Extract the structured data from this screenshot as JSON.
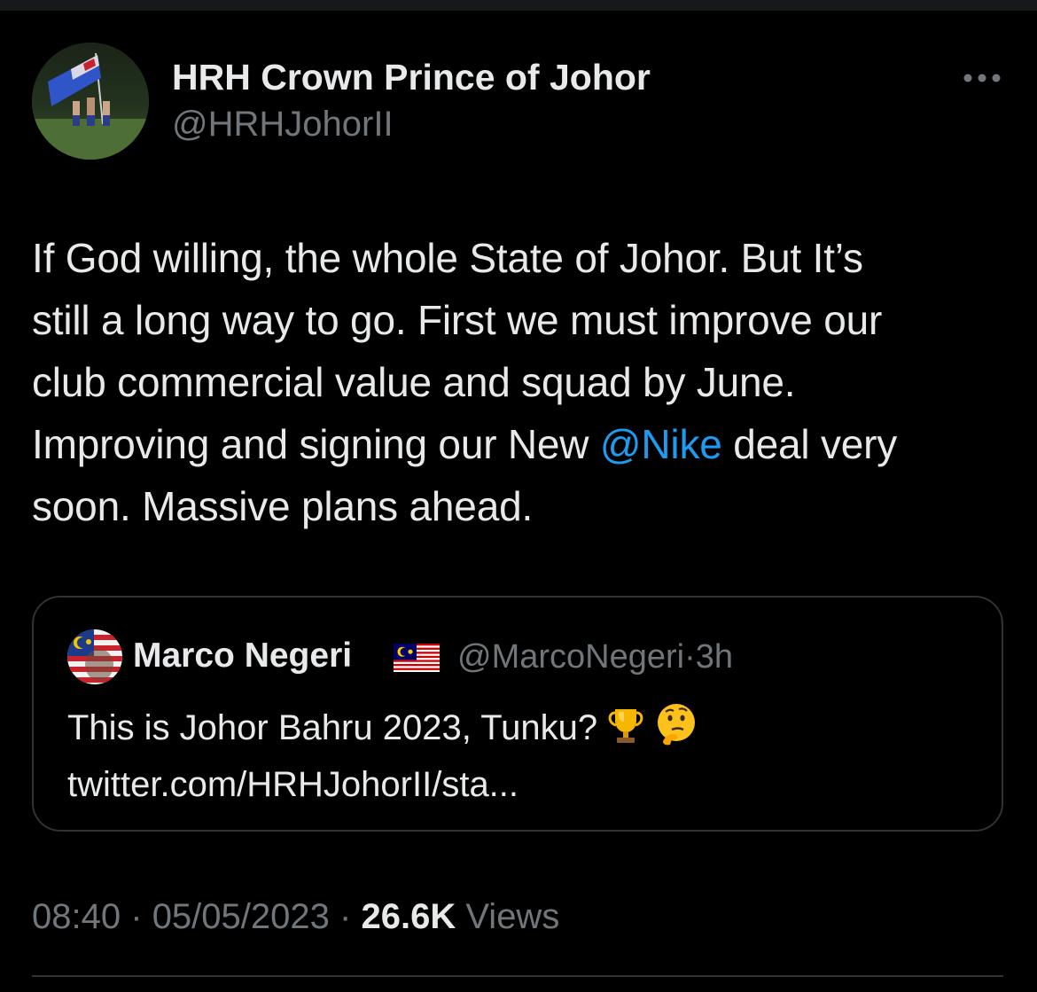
{
  "author": {
    "name": "HRH Crown Prince of Johor",
    "handle": "@HRHJohorII"
  },
  "tweet": {
    "lines": [
      "If God willing, the whole State of Johor. But It’s",
      "still a long way to go. First we must improve our",
      "club commercial value and squad by June."
    ],
    "line4_before": "Improving and signing our New ",
    "mention": "@Nike",
    "line4_after": " deal very",
    "line5": "soon. Massive plans ahead."
  },
  "quote": {
    "name": "Marco Negeri",
    "handle": "@MarcoNegeri",
    "separator": "·",
    "time": "3h",
    "text_line1": "This is Johor Bahru 2023, Tunku?",
    "text_line2": "twitter.com/HRHJohorII/sta...",
    "emojis": [
      "trophy-emoji",
      "thinking-face-emoji"
    ]
  },
  "meta": {
    "time": "08:40",
    "date": "05/05/2023",
    "separator": "·",
    "views_count": "26.6K",
    "views_label": "Views"
  },
  "colors": {
    "background": "#000000",
    "text": "#e7e9ea",
    "secondary": "#71767b",
    "link": "#1d9bf0",
    "border": "#2f3336"
  },
  "icons": {
    "more": "more-horizontal-icon",
    "flag": "malaysia-flag-icon"
  }
}
